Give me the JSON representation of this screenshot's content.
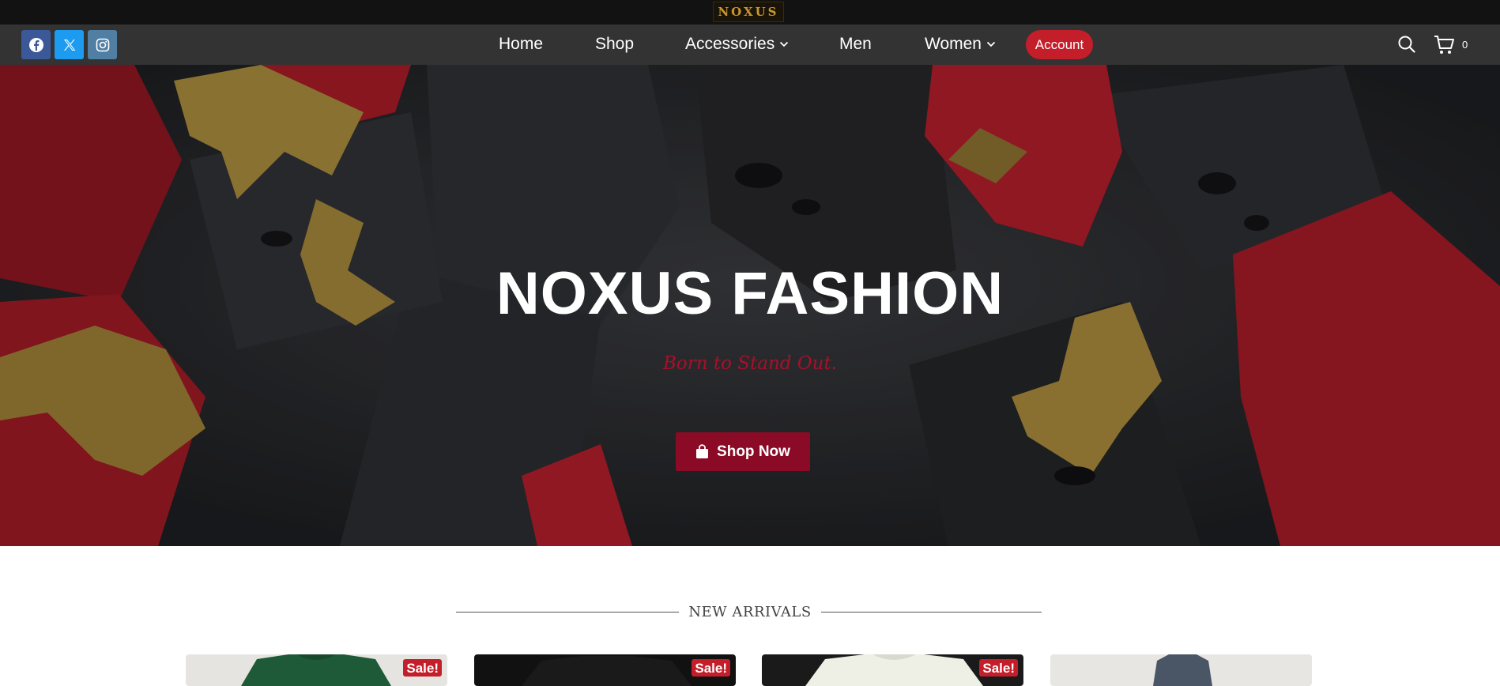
{
  "header": {
    "logo_text": "NOXUS",
    "social": [
      {
        "name": "facebook-icon",
        "color": "#3b5998"
      },
      {
        "name": "x-twitter-icon",
        "color": "#1d9bf0"
      },
      {
        "name": "instagram-icon",
        "color": "#517fa4"
      }
    ],
    "nav": {
      "home": "Home",
      "shop": "Shop",
      "accessories": "Accessories",
      "men": "Men",
      "women": "Women",
      "account": "Account"
    },
    "cart_count": "0"
  },
  "hero": {
    "title": "NOXUS FASHION",
    "subtitle": "Born to Stand Out.",
    "cta_label": "Shop Now"
  },
  "arrivals": {
    "title": "NEW ARRIVALS",
    "products": [
      {
        "badge": "Sale!",
        "shirt_color": "#1e5a37",
        "bg": "#e6e4e0"
      },
      {
        "badge": "Sale!",
        "shirt_color": "#161616",
        "bg": "#111111"
      },
      {
        "badge": "Sale!",
        "shirt_color": "#eef0e6",
        "bg": "#1a1a1a"
      },
      {
        "badge": "",
        "shirt_color": "#4a5566",
        "bg": "#e7e6e3"
      }
    ]
  },
  "colors": {
    "accent_red": "#c41e2a",
    "cta_red": "#8b0a26",
    "nav_bg": "#333333",
    "topbar_bg": "#121212",
    "gold": "#c9962b"
  }
}
